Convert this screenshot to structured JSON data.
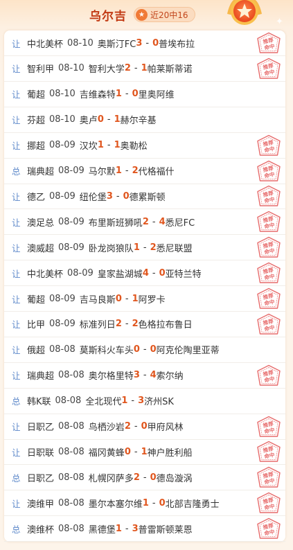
{
  "header": {
    "title": "乌尔吉",
    "record": "近20中16",
    "badge_icon": "star-icon"
  },
  "stamp_text": [
    "推荐",
    "命中"
  ],
  "colors": {
    "score": "#e0561e",
    "kind": "#5b87c9",
    "title": "#c23a14",
    "stamp": "#e76b6b"
  },
  "rows": [
    {
      "kind": "让",
      "league": "中北美杯",
      "date": "08-10",
      "home": "奥斯汀FC",
      "hs": "3",
      "as": "0",
      "away": "普埃布拉",
      "hit": true
    },
    {
      "kind": "让",
      "league": "智利甲",
      "date": "08-10",
      "home": "智利大学",
      "hs": "2",
      "as": "1",
      "away": "帕莱斯蒂诺",
      "hit": true
    },
    {
      "kind": "让",
      "league": "葡超",
      "date": "08-10",
      "home": "吉维森特",
      "hs": "1",
      "as": "0",
      "away": "里奥阿维",
      "hit": false
    },
    {
      "kind": "让",
      "league": "芬超",
      "date": "08-10",
      "home": "奥卢",
      "hs": "0",
      "as": "1",
      "away": "赫尔辛基",
      "hit": false
    },
    {
      "kind": "让",
      "league": "挪超",
      "date": "08-09",
      "home": "汉坎",
      "hs": "1",
      "as": "1",
      "away": "奥勒松",
      "hit": true
    },
    {
      "kind": "总",
      "league": "瑞典超",
      "date": "08-09",
      "home": "马尔默",
      "hs": "1",
      "as": "2",
      "away": "代格福什",
      "hit": true
    },
    {
      "kind": "让",
      "league": "德乙",
      "date": "08-09",
      "home": "纽伦堡",
      "hs": "3",
      "as": "0",
      "away": "德累斯顿",
      "hit": true
    },
    {
      "kind": "让",
      "league": "澳足总",
      "date": "08-09",
      "home": "布里斯班狮吼",
      "hs": "2",
      "as": "4",
      "away": "悉尼FC",
      "hit": true
    },
    {
      "kind": "让",
      "league": "澳威超",
      "date": "08-09",
      "home": "卧龙岗狼队",
      "hs": "1",
      "as": "2",
      "away": "悉尼联盟",
      "hit": true
    },
    {
      "kind": "让",
      "league": "中北美杯",
      "date": "08-09",
      "home": "皇家盐湖城",
      "hs": "4",
      "as": "0",
      "away": "亚特兰特",
      "hit": true
    },
    {
      "kind": "让",
      "league": "葡超",
      "date": "08-09",
      "home": "吉马良斯",
      "hs": "0",
      "as": "1",
      "away": "阿罗卡",
      "hit": true
    },
    {
      "kind": "让",
      "league": "比甲",
      "date": "08-09",
      "home": "标准列日",
      "hs": "2",
      "as": "2",
      "away": "色格拉布鲁日",
      "hit": true
    },
    {
      "kind": "让",
      "league": "俄超",
      "date": "08-08",
      "home": "莫斯科火车头",
      "hs": "0",
      "as": "0",
      "away": "阿克伦陶里亚蒂",
      "hit": false
    },
    {
      "kind": "让",
      "league": "瑞典超",
      "date": "08-08",
      "home": "奥尔格里特",
      "hs": "3",
      "as": "4",
      "away": "索尔纳",
      "hit": true
    },
    {
      "kind": "总",
      "league": "韩K联",
      "date": "08-08",
      "home": "全北现代",
      "hs": "1",
      "as": "3",
      "away": "济州SK",
      "hit": false
    },
    {
      "kind": "让",
      "league": "日职乙",
      "date": "08-08",
      "home": "鸟栖沙岩",
      "hs": "2",
      "as": "0",
      "away": "甲府风林",
      "hit": true
    },
    {
      "kind": "让",
      "league": "日职联",
      "date": "08-08",
      "home": "福冈黄蜂",
      "hs": "0",
      "as": "1",
      "away": "神户胜利船",
      "hit": true
    },
    {
      "kind": "总",
      "league": "日职乙",
      "date": "08-08",
      "home": "札幌冈萨多",
      "hs": "2",
      "as": "0",
      "away": "德岛漩涡",
      "hit": true
    },
    {
      "kind": "让",
      "league": "澳维甲",
      "date": "08-08",
      "home": "墨尔本塞尔维",
      "hs": "1",
      "as": "0",
      "away": "北部吉隆勇士",
      "hit": true
    },
    {
      "kind": "总",
      "league": "澳维杯",
      "date": "08-08",
      "home": "黑德堡",
      "hs": "1",
      "as": "3",
      "away": "普雷斯顿莱恩",
      "hit": true
    }
  ]
}
